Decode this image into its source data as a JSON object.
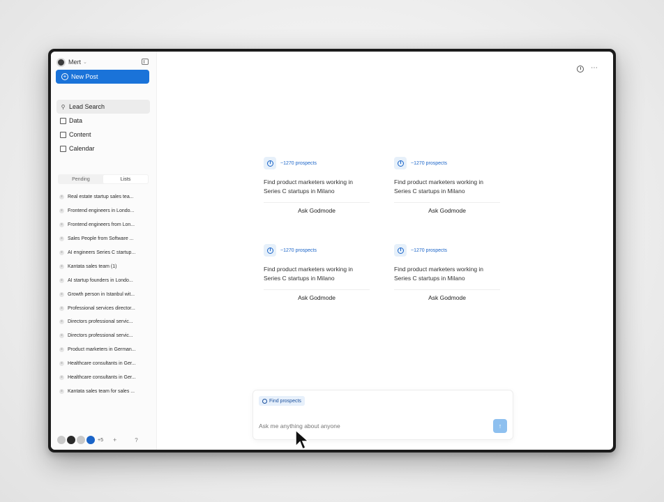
{
  "user": {
    "name": "Mert"
  },
  "sidebar": {
    "new_post": "New Post",
    "nav": [
      {
        "label": "Lead Search",
        "icon": "search-icon",
        "active": true
      },
      {
        "label": "Data",
        "icon": "table-icon",
        "active": false
      },
      {
        "label": "Content",
        "icon": "content-icon",
        "active": false
      },
      {
        "label": "Calendar",
        "icon": "calendar-icon",
        "active": false
      }
    ],
    "tabs": [
      "Pending",
      "Lists"
    ],
    "lists": [
      "Real estate startup sales tea...",
      "Frontend engineers in Londo...",
      "Frontend engineers from Lon...",
      "Sales People from Software ...",
      "AI engineers Series C startup...",
      "Kantata sales team (1)",
      "AI startup founders in Londo...",
      "Growth person in Istanbul wit...",
      "Professional services director...",
      "Directors professional servic...",
      "Directors professional servic...",
      "Product marketers in German...",
      "Healthcare consultants in Ger...",
      "Healthcare consultants in Ger...",
      "Kantata sales team for sales ..."
    ],
    "more_count": "+5",
    "add_label": "+",
    "help_label": "?"
  },
  "cards": [
    {
      "count": "~1270 prospects",
      "description": "Find product marketers working in Series C startups in Milano",
      "action": "Ask Godmode"
    },
    {
      "count": "~1270 prospects",
      "description": "Find product marketers working in Series C startups in Milano",
      "action": "Ask Godmode"
    },
    {
      "count": "~1270 prospects",
      "description": "Find product marketers working in Series C startups in Milano",
      "action": "Ask Godmode"
    },
    {
      "count": "~1270 prospects",
      "description": "Find product marketers working in Series C startups in Milano",
      "action": "Ask Godmode"
    }
  ],
  "composer": {
    "chip": "Find prospects",
    "placeholder": "Ask me anything about anyone",
    "send_icon": "↑"
  },
  "colors": {
    "accent": "#1a73d9",
    "send": "#8ec0ef"
  }
}
